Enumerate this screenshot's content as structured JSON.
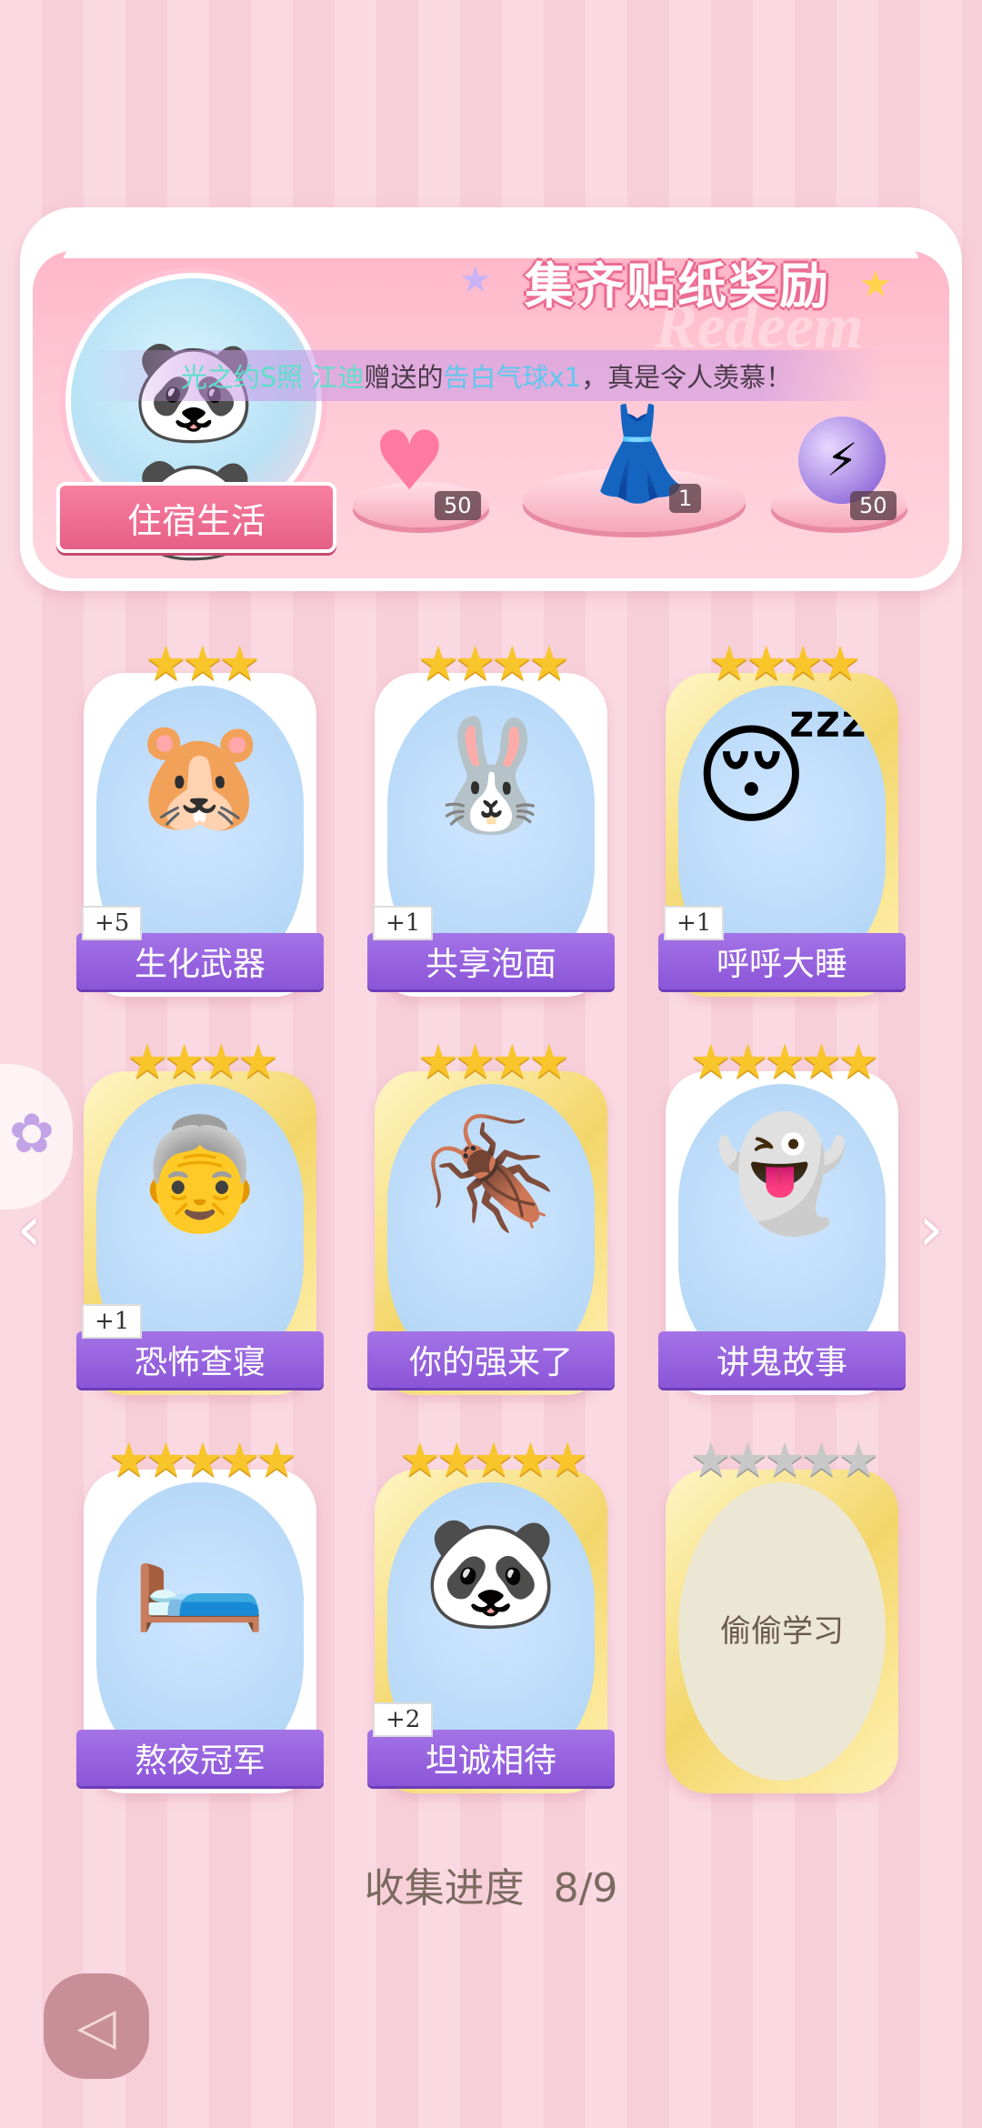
{
  "reward": {
    "title": "集齐贴纸奖励",
    "watermark": "Redeem",
    "broadcast": {
      "user": "光之约S照 江迪",
      "mid": "赠送的",
      "item": "告白气球x1",
      "tail": "，真是令人羡慕！"
    },
    "album_label": "住宿生活",
    "items": [
      {
        "name": "heart-gem",
        "icon": "💎",
        "count": "50"
      },
      {
        "name": "dress",
        "icon": "👗",
        "count": "1"
      },
      {
        "name": "lightning-orb",
        "icon": "⚡",
        "count": "50"
      }
    ]
  },
  "stickers": [
    {
      "title": "生化武器",
      "stars": 3,
      "dup": "+5",
      "art": "🐹",
      "gold": false
    },
    {
      "title": "共享泡面",
      "stars": 4,
      "dup": "+1",
      "art": "🐰",
      "gold": false
    },
    {
      "title": "呼呼大睡",
      "stars": 4,
      "dup": "+1",
      "art": "😴",
      "gold": true
    },
    {
      "title": "恐怖查寝",
      "stars": 4,
      "dup": "+1",
      "art": "👵",
      "gold": true
    },
    {
      "title": "你的强来了",
      "stars": 4,
      "dup": "",
      "art": "🪳",
      "gold": true
    },
    {
      "title": "讲鬼故事",
      "stars": 5,
      "dup": "",
      "art": "👻",
      "gold": false
    },
    {
      "title": "熬夜冠军",
      "stars": 5,
      "dup": "",
      "art": "🛏️",
      "gold": false
    },
    {
      "title": "坦诚相待",
      "stars": 5,
      "dup": "+2",
      "art": "🐼",
      "gold": true
    },
    {
      "title": "偷偷学习",
      "stars": 5,
      "dup": "",
      "art": "",
      "gold": true,
      "locked": true
    }
  ],
  "progress": {
    "label": "收集进度",
    "value": "8/9"
  },
  "icons": {
    "back": "back-icon",
    "prev": "chevron-left-icon",
    "next": "chevron-right-icon"
  }
}
